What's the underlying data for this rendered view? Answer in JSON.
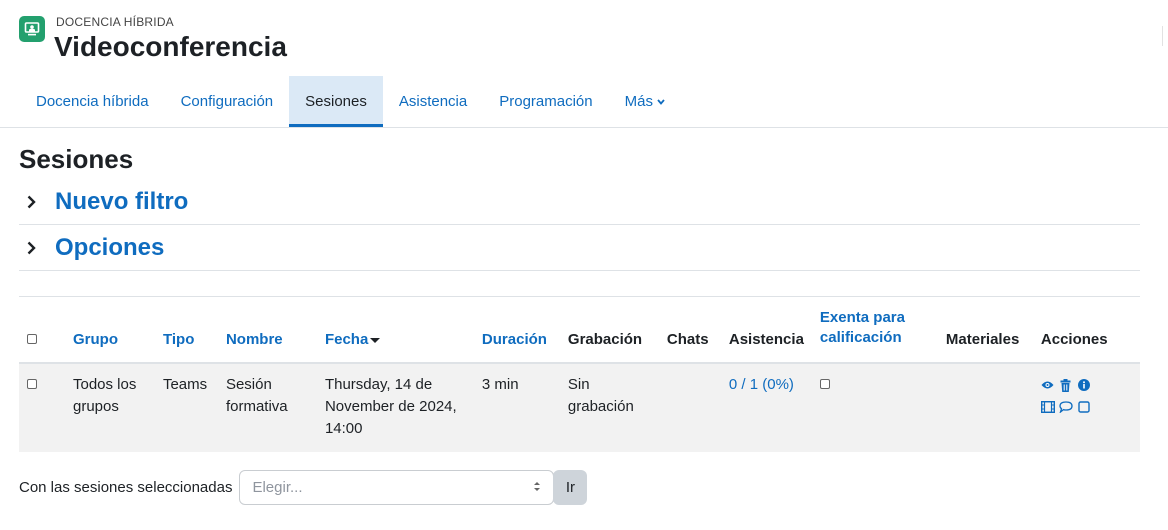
{
  "header": {
    "icon": "video-conference-icon",
    "pretitle": "DOCENCIA HÍBRIDA",
    "title": "Videoconferencia"
  },
  "nav": {
    "tabs": [
      {
        "label": "Docencia híbrida",
        "active": false
      },
      {
        "label": "Configuración",
        "active": false
      },
      {
        "label": "Sesiones",
        "active": true
      },
      {
        "label": "Asistencia",
        "active": false
      },
      {
        "label": "Programación",
        "active": false
      },
      {
        "label": "Más",
        "active": false,
        "dropdown": true
      }
    ]
  },
  "main": {
    "heading": "Sesiones",
    "collapsibles": [
      "Nuevo filtro",
      "Opciones"
    ]
  },
  "table": {
    "headers": {
      "grupo": "Grupo",
      "tipo": "Tipo",
      "nombre": "Nombre",
      "fecha": "Fecha",
      "duracion": "Duración",
      "grabacion": "Grabación",
      "chats": "Chats",
      "asistencia": "Asistencia",
      "exenta_1": "Exenta para",
      "exenta_2": "calificación",
      "materiales": "Materiales",
      "acciones": "Acciones"
    },
    "rows": [
      {
        "grupo_1": "Todos los",
        "grupo_2": "grupos",
        "tipo": "Teams",
        "nombre_1": "Sesión",
        "nombre_2": "formativa",
        "fecha_1": "Thursday, 14 de",
        "fecha_2": "November de 2024,",
        "fecha_3": "14:00",
        "duracion": "3 min",
        "grabacion_1": "Sin",
        "grabacion_2": "grabación",
        "chats": "",
        "asistencia": "0 / 1 (0%)",
        "materiales": "",
        "actions": [
          "eye-icon",
          "trash-icon",
          "info-icon",
          "film-icon",
          "comment-icon",
          "square-icon"
        ]
      }
    ]
  },
  "bulk": {
    "label": "Con las sesiones seleccionadas",
    "placeholder": "Elegir...",
    "button": "Ir"
  },
  "colors": {
    "accent": "#0f6cbf",
    "module_icon": "#23a06e",
    "active_tab_bg": "#dbe9f6"
  }
}
